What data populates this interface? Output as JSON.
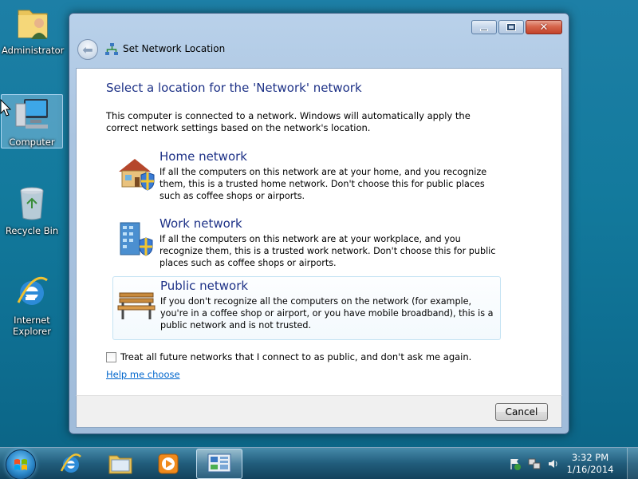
{
  "desktop": {
    "icons": [
      {
        "label": "Administrator",
        "icon": "user-folder-icon"
      },
      {
        "label": "Computer",
        "icon": "computer-icon"
      },
      {
        "label": "Recycle Bin",
        "icon": "recycle-bin-icon"
      },
      {
        "label": "Internet Explorer",
        "icon": "internet-explorer-icon"
      }
    ]
  },
  "window": {
    "title": "Set Network Location",
    "heading": "Select a location for the 'Network' network",
    "intro": "This computer is connected to a network. Windows will automatically apply the correct network settings based on the network's location.",
    "options": [
      {
        "title": "Home network",
        "description": "If all the computers on this network are at your home, and you recognize them, this is a trusted home network.  Don't choose this for public places such as coffee shops or airports.",
        "icon": "home-network-icon"
      },
      {
        "title": "Work network",
        "description": "If all the computers on this network are at your workplace, and you recognize them, this is a trusted work network.  Don't choose this for public places such as coffee shops or airports.",
        "icon": "work-network-icon"
      },
      {
        "title": "Public network",
        "description": "If you don't recognize all the computers on the network (for example, you're in a coffee shop or airport, or you have mobile broadband), this is a public network and is not trusted.",
        "icon": "public-network-bench-icon"
      }
    ],
    "checkbox_label": "Treat all future networks that I connect to as public, and don't ask me again.",
    "checkbox_checked": false,
    "help_link": "Help me choose",
    "cancel_label": "Cancel"
  },
  "taskbar": {
    "pinned": [
      "internet-explorer-icon",
      "windows-explorer-icon",
      "media-player-icon",
      "network-control-panel-icon"
    ],
    "active_item": "network-control-panel-icon",
    "clock": {
      "time": "3:32 PM",
      "date": "1/16/2014"
    }
  },
  "colors": {
    "heading": "#1e3287",
    "link": "#0066cc"
  }
}
